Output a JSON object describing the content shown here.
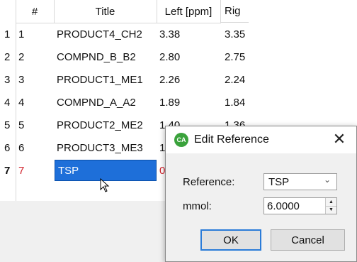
{
  "table": {
    "headers": {
      "sort": "#",
      "title": "Title",
      "left": "Left [ppm]",
      "right": "Rig"
    },
    "rows": [
      {
        "row": "1",
        "num": "1",
        "title": "PRODUCT4_CH2",
        "left": "3.38",
        "right": "3.35"
      },
      {
        "row": "2",
        "num": "2",
        "title": "COMPND_B_B2",
        "left": "2.80",
        "right": "2.75"
      },
      {
        "row": "3",
        "num": "3",
        "title": "PRODUCT1_ME1",
        "left": "2.26",
        "right": "2.24"
      },
      {
        "row": "4",
        "num": "4",
        "title": "COMPND_A_A2",
        "left": "1.89",
        "right": "1.84"
      },
      {
        "row": "5",
        "num": "5",
        "title": "PRODUCT2_ME2",
        "left": "1.40",
        "right": "1.36"
      },
      {
        "row": "6",
        "num": "6",
        "title": "PRODUCT3_ME3",
        "left": "1",
        "right": ""
      },
      {
        "row": "7",
        "num": "7",
        "title": "TSP",
        "left": "0",
        "right": ""
      }
    ]
  },
  "dialog": {
    "title": "Edit Reference",
    "icon_text": "CA",
    "reference_label": "Reference:",
    "reference_value": "TSP",
    "mmol_label": "mmol:",
    "mmol_value": "6.0000",
    "ok_label": "OK",
    "cancel_label": "Cancel",
    "close_symbol": "✕"
  },
  "colors": {
    "selection": "#1e6fd9",
    "highlight_text": "#d0202a",
    "app_icon": "#3aa23c"
  }
}
